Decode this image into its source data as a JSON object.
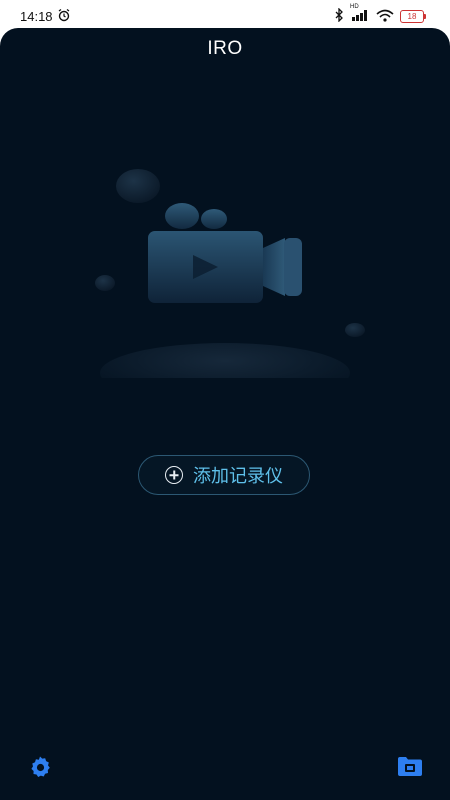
{
  "status_bar": {
    "time": "14:18",
    "battery": "18",
    "network_label": "HD"
  },
  "header": {
    "title": "IRO"
  },
  "main": {
    "add_button_label": "添加记录仪"
  },
  "footer": {
    "settings_icon": "gear-icon",
    "gallery_icon": "folder-icon"
  },
  "colors": {
    "background": "#03111f",
    "accent": "#2e7ff0",
    "button_text": "#5fc0ea"
  }
}
